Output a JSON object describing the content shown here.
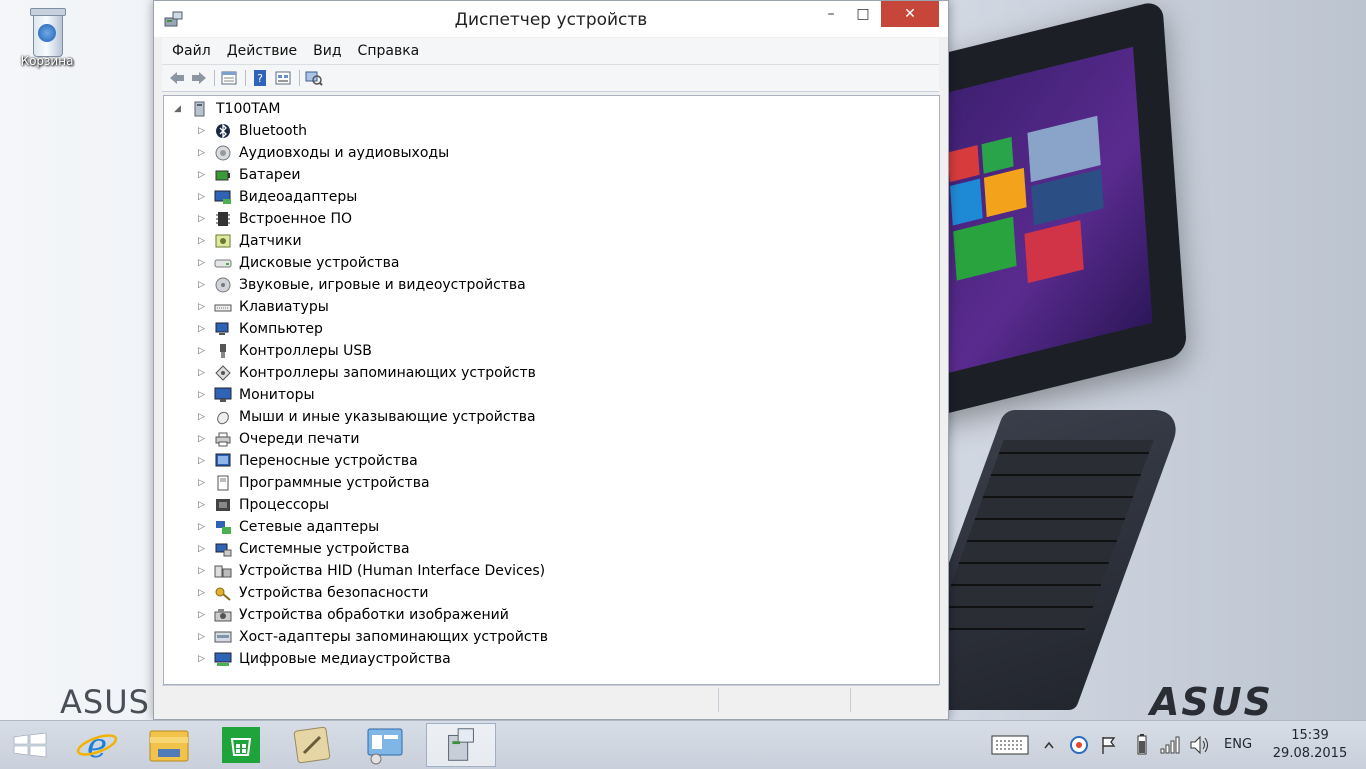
{
  "desktop": {
    "recycle_bin_label": "Корзина",
    "brand_left": "ASUS T",
    "brand_right": "ASUS"
  },
  "window": {
    "title": "Диспетчер устройств",
    "controls": {
      "minimize": "–",
      "maximize": "□",
      "close": "✕"
    },
    "menu": [
      "Файл",
      "Действие",
      "Вид",
      "Справка"
    ],
    "toolbar_icons": [
      "back-arrow-icon",
      "forward-arrow-icon",
      "properties-icon",
      "help-icon",
      "view-icon",
      "scan-hardware-icon"
    ]
  },
  "tree": {
    "root": "T100TAM",
    "categories": [
      {
        "label": "Bluetooth",
        "icon": "bluetooth-icon"
      },
      {
        "label": "Аудиовходы и аудиовыходы",
        "icon": "audio-io-icon"
      },
      {
        "label": "Батареи",
        "icon": "battery-icon"
      },
      {
        "label": "Видеоадаптеры",
        "icon": "display-adapter-icon"
      },
      {
        "label": "Встроенное ПО",
        "icon": "firmware-icon"
      },
      {
        "label": "Датчики",
        "icon": "sensor-icon"
      },
      {
        "label": "Дисковые устройства",
        "icon": "disk-drive-icon"
      },
      {
        "label": "Звуковые, игровые и видеоустройства",
        "icon": "sound-icon"
      },
      {
        "label": "Клавиатуры",
        "icon": "keyboard-icon"
      },
      {
        "label": "Компьютер",
        "icon": "computer-icon"
      },
      {
        "label": "Контроллеры USB",
        "icon": "usb-icon"
      },
      {
        "label": "Контроллеры запоминающих устройств",
        "icon": "storage-controller-icon"
      },
      {
        "label": "Мониторы",
        "icon": "monitor-icon"
      },
      {
        "label": "Мыши и иные указывающие устройства",
        "icon": "mouse-icon"
      },
      {
        "label": "Очереди печати",
        "icon": "print-queue-icon"
      },
      {
        "label": "Переносные устройства",
        "icon": "portable-device-icon"
      },
      {
        "label": "Программные устройства",
        "icon": "software-device-icon"
      },
      {
        "label": "Процессоры",
        "icon": "processor-icon"
      },
      {
        "label": "Сетевые адаптеры",
        "icon": "network-adapter-icon"
      },
      {
        "label": "Системные устройства",
        "icon": "system-device-icon"
      },
      {
        "label": "Устройства HID (Human Interface Devices)",
        "icon": "hid-icon"
      },
      {
        "label": "Устройства безопасности",
        "icon": "security-device-icon"
      },
      {
        "label": "Устройства обработки изображений",
        "icon": "imaging-device-icon"
      },
      {
        "label": "Хост-адаптеры запоминающих устройств",
        "icon": "storage-host-icon"
      },
      {
        "label": "Цифровые медиаустройства",
        "icon": "digital-media-icon"
      }
    ]
  },
  "taskbar": {
    "apps": [
      "start-icon",
      "internet-explorer-icon",
      "file-explorer-icon",
      "store-icon",
      "control-panel-icon",
      "remote-desktop-icon",
      "device-manager-icon"
    ],
    "active_app": "device-manager-icon",
    "tray_icons": [
      "touch-keyboard-icon",
      "show-hidden-icons-icon",
      "security-shield-icon",
      "action-center-flag-icon",
      "battery-icon",
      "signal-icon",
      "volume-icon"
    ],
    "language": "ENG",
    "time": "15:39",
    "date": "29.08.2015"
  },
  "colors": {
    "close_button": "#c7463a",
    "tree_background": "#ffffff",
    "window_chrome": "#f0f0f0",
    "accent_blue": "#1f6fc5"
  }
}
